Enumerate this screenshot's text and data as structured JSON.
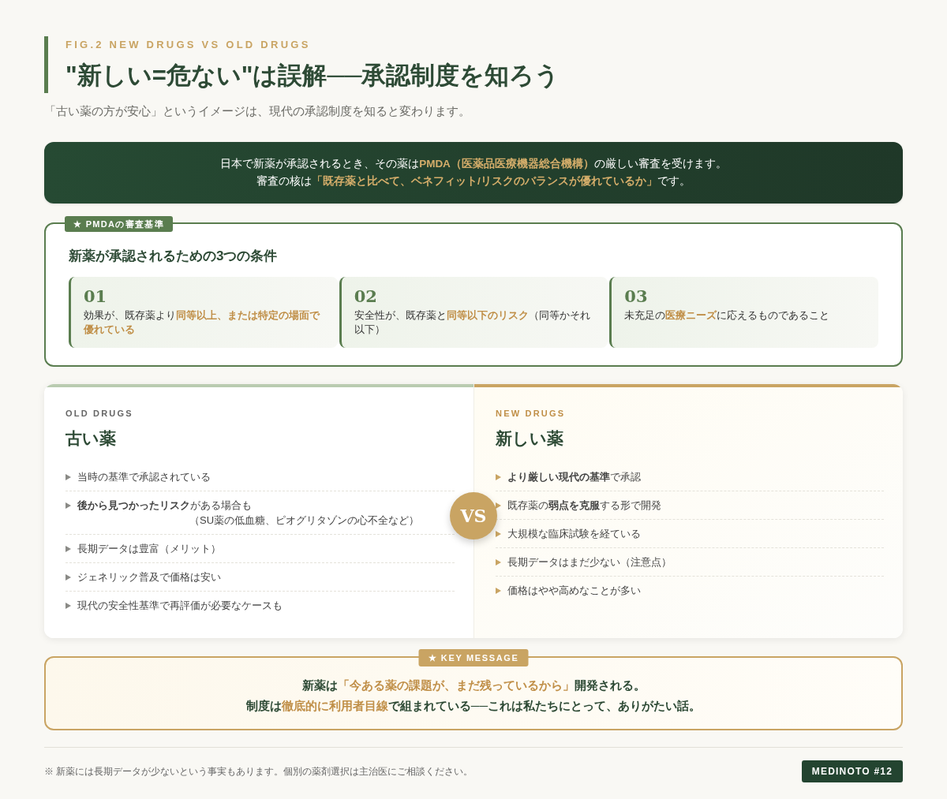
{
  "header": {
    "eyebrow": "FIG.2 NEW DRUGS VS OLD DRUGS",
    "title": "\"新しい=危ない\"は誤解──承認制度を知ろう",
    "subtitle": "「古い薬の方が安心」というイメージは、現代の承認制度を知ると変わります。"
  },
  "banner": {
    "lines": [
      "日本で新薬が承認されるとき、その薬は**PMDA（医薬品医療機器総合機構）**の厳しい審査を受けます。",
      "審査の核は**「既存薬と比べて、ベネフィット/リスクのバランスが優れているか」**です。"
    ]
  },
  "criteria": {
    "badge": "★ PMDAの審査基準",
    "heading": "新薬が承認されるための3つの条件",
    "items": [
      {
        "number": "01",
        "text": "効果が、既存薬より**同等以上、または特定の場面で優れている**"
      },
      {
        "number": "02",
        "text": "安全性が、既存薬と**同等以下のリスク**（同等かそれ以下）"
      },
      {
        "number": "03",
        "text": "未充足の**医療ニーズ**に応えるものであること"
      }
    ]
  },
  "comparison": {
    "vs": "VS",
    "columns": [
      {
        "kind": "old",
        "eyebrow": "OLD DRUGS",
        "title": "古い薬",
        "items": [
          {
            "text": "当時の基準で承認されている"
          },
          {
            "text": "**後から見つかったリスク**がある場合も",
            "note": "（SU薬の低血糖、ピオグリタゾンの心不全など）"
          },
          {
            "text": "長期データは豊富（メリット）"
          },
          {
            "text": "ジェネリック普及で価格は安い"
          },
          {
            "text": "現代の安全性基準で再評価が必要なケースも"
          }
        ]
      },
      {
        "kind": "new",
        "eyebrow": "NEW DRUGS",
        "title": "新しい薬",
        "items": [
          {
            "text": "**より厳しい現代の基準**で承認"
          },
          {
            "text": "既存薬の**弱点を克服**する形で開発"
          },
          {
            "text": "大規模な臨床試験を経ている"
          },
          {
            "text": "長期データはまだ少ない（注意点）"
          },
          {
            "text": "価格はやや高めなことが多い"
          }
        ]
      }
    ]
  },
  "key_message": {
    "badge": "★ KEY MESSAGE",
    "lines": [
      "新薬は**「今ある薬の課題が、まだ残っているから」**開発される。",
      "制度は**徹底的に利用者目線**で組まれている──これは私たちにとって、ありがたい話。"
    ]
  },
  "footer": {
    "note": "※ 新薬には長期データが少ないという事実もあります。個別の薬剤選択は主治医にご相談ください。",
    "tag": "MEDINOTO #12"
  }
}
